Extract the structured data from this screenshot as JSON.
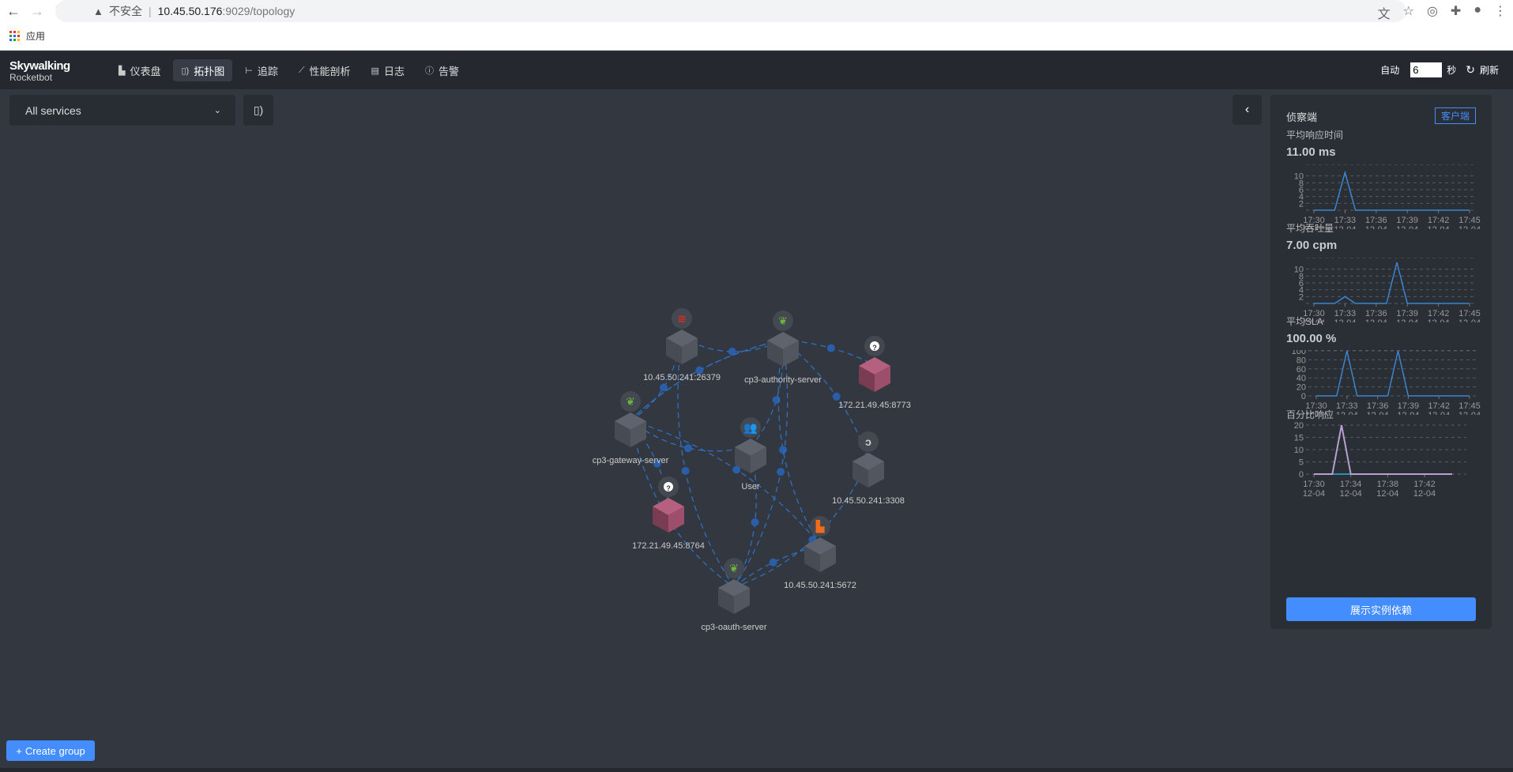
{
  "browser": {
    "insecure_label": "不安全",
    "url_host": "10.45.50.176",
    "url_path": ":9029/topology",
    "bookmark_apps": "应用"
  },
  "header": {
    "logo_line1": "Skywalking",
    "logo_line2": "Rocketbot",
    "nav": [
      {
        "label": "仪表盘",
        "icon": "chart-icon"
      },
      {
        "label": "拓扑图",
        "icon": "topology-icon",
        "active": true
      },
      {
        "label": "追踪",
        "icon": "trace-icon"
      },
      {
        "label": "性能剖析",
        "icon": "profile-icon"
      },
      {
        "label": "日志",
        "icon": "log-icon"
      },
      {
        "label": "告警",
        "icon": "alarm-icon"
      }
    ],
    "auto_label": "自动",
    "interval_value": "6",
    "seconds_label": "秒",
    "refresh_label": "刷新"
  },
  "toolbar": {
    "service_select": "All services"
  },
  "create_group": "Create group",
  "colors": {
    "accent": "#448dfe",
    "edge": "#2f6fc0",
    "cube": "#4d525c",
    "unknown_cube": "#9c4e6a",
    "spring": "#6db33f",
    "redis": "#d82c20",
    "rabbit": "#f06b1c",
    "user": "#2a9fe8"
  },
  "topology": {
    "nodes": [
      {
        "id": "redis",
        "name": "10.45.50.241:26379",
        "icon": "redis-icon"
      },
      {
        "id": "auth",
        "name": "cp3-authority-server",
        "icon": "spring-leaf-icon"
      },
      {
        "id": "u8773",
        "name": "172.21.49.45:8773",
        "icon": "unknown-icon"
      },
      {
        "id": "gw",
        "name": "cp3-gateway-server",
        "icon": "spring-leaf-icon"
      },
      {
        "id": "user",
        "name": "User",
        "icon": "users-icon"
      },
      {
        "id": "mysql",
        "name": "10.45.50.241:3308",
        "icon": "mysql-icon"
      },
      {
        "id": "u8764",
        "name": "172.21.49.45:8764",
        "icon": "unknown-icon"
      },
      {
        "id": "mq",
        "name": "10.45.50.241:5672",
        "icon": "rabbitmq-icon"
      },
      {
        "id": "oauth",
        "name": "cp3-oauth-server",
        "icon": "spring-leaf-icon"
      }
    ],
    "edges": [
      [
        "user",
        "gw"
      ],
      [
        "user",
        "auth"
      ],
      [
        "user",
        "oauth"
      ],
      [
        "gw",
        "redis"
      ],
      [
        "gw",
        "u8764"
      ],
      [
        "gw",
        "oauth"
      ],
      [
        "gw",
        "mq"
      ],
      [
        "auth",
        "gw"
      ],
      [
        "auth",
        "u8773"
      ],
      [
        "auth",
        "mq"
      ],
      [
        "auth",
        "mysql"
      ],
      [
        "redis",
        "auth"
      ],
      [
        "oauth",
        "mq"
      ],
      [
        "oauth",
        "mysql"
      ],
      [
        "oauth",
        "redis"
      ],
      [
        "oauth",
        "auth"
      ],
      [
        "gw",
        "auth"
      ]
    ]
  },
  "panel": {
    "title": "侦察端",
    "client_button": "客户端",
    "show_instances_button": "展示实例依赖",
    "metrics": [
      {
        "label": "平均响应时间",
        "value": "11.00 ms"
      },
      {
        "label": "平均吞吐量",
        "value": "7.00 cpm"
      },
      {
        "label": "平均SLA",
        "value": "100.00 %"
      },
      {
        "label": "百分比响应",
        "value": ""
      }
    ]
  },
  "chart_data": [
    {
      "type": "line",
      "title": "平均响应时间",
      "x": [
        "17:30",
        "17:31",
        "17:32",
        "17:33",
        "17:34",
        "17:35",
        "17:36",
        "17:37",
        "17:38",
        "17:39",
        "17:40",
        "17:41",
        "17:42",
        "17:43",
        "17:44",
        "17:45"
      ],
      "date": "12-04",
      "xticks": [
        "17:30",
        "17:33",
        "17:36",
        "17:39",
        "17:42",
        "17:45"
      ],
      "yticks": [
        2,
        4,
        6,
        8,
        10
      ],
      "ylim": [
        0,
        12
      ],
      "series": [
        {
          "values": [
            0,
            0,
            0,
            11,
            0,
            0,
            0,
            0,
            0,
            0,
            0,
            0,
            0,
            0,
            0,
            0
          ],
          "color": "#3a86d0"
        }
      ],
      "grid": true
    },
    {
      "type": "line",
      "title": "平均吞吐量",
      "x": [
        "17:30",
        "17:31",
        "17:32",
        "17:33",
        "17:34",
        "17:35",
        "17:36",
        "17:37",
        "17:38",
        "17:39",
        "17:40",
        "17:41",
        "17:42",
        "17:43",
        "17:44",
        "17:45"
      ],
      "date": "12-04",
      "xticks": [
        "17:30",
        "17:33",
        "17:36",
        "17:39",
        "17:42",
        "17:45"
      ],
      "yticks": [
        2,
        4,
        6,
        8,
        10
      ],
      "ylim": [
        0,
        12
      ],
      "series": [
        {
          "values": [
            0,
            0,
            0,
            2,
            0,
            0,
            0,
            0,
            12,
            0,
            0,
            0,
            0,
            0,
            0,
            0
          ],
          "color": "#3a86d0"
        }
      ],
      "grid": true
    },
    {
      "type": "line",
      "title": "平均SLA",
      "x": [
        "17:30",
        "17:31",
        "17:32",
        "17:33",
        "17:34",
        "17:35",
        "17:36",
        "17:37",
        "17:38",
        "17:39",
        "17:40",
        "17:41",
        "17:42",
        "17:43",
        "17:44",
        "17:45"
      ],
      "date": "12-04",
      "xticks": [
        "17:30",
        "17:33",
        "17:36",
        "17:39",
        "17:42",
        "17:45"
      ],
      "yticks": [
        0,
        20,
        40,
        60,
        80,
        100
      ],
      "ylim": [
        0,
        100
      ],
      "series": [
        {
          "values": [
            0,
            0,
            0,
            100,
            0,
            0,
            0,
            0,
            100,
            0,
            0,
            0,
            0,
            0,
            0,
            0
          ],
          "color": "#3a86d0"
        }
      ],
      "grid": true
    },
    {
      "type": "line",
      "title": "百分比响应",
      "x": [
        "17:30",
        "17:31",
        "17:32",
        "17:33",
        "17:34",
        "17:35",
        "17:36",
        "17:37",
        "17:38",
        "17:39",
        "17:40",
        "17:41",
        "17:42",
        "17:43",
        "17:44",
        "17:45"
      ],
      "date": "12-04",
      "xticks": [
        "17:30",
        "17:34",
        "17:38",
        "17:42"
      ],
      "yticks": [
        0,
        5,
        10,
        15,
        20
      ],
      "ylim": [
        0,
        20
      ],
      "series": [
        {
          "values": [
            0,
            0,
            0,
            0,
            0,
            0,
            0,
            0,
            0,
            0,
            0,
            0,
            0,
            0,
            0,
            0
          ],
          "color": "#2a8fb0"
        },
        {
          "values": [
            0,
            0,
            0,
            20,
            0,
            0,
            0,
            0,
            0,
            0,
            0,
            0,
            0,
            0,
            0,
            0
          ],
          "color": "#b8a0d0"
        }
      ],
      "grid": true
    }
  ]
}
